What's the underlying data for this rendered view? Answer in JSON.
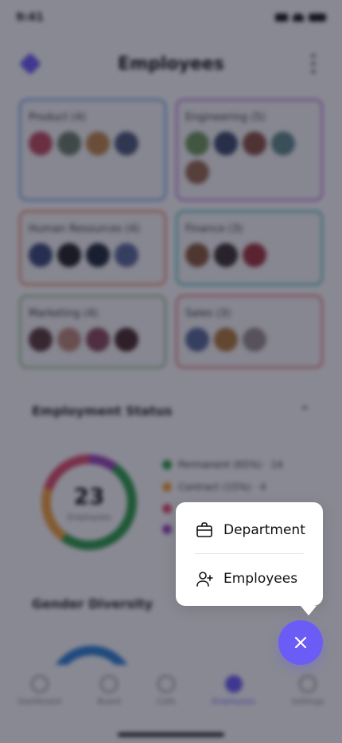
{
  "status_bar": {
    "time": "9:41"
  },
  "header": {
    "title": "Employees"
  },
  "departments": [
    {
      "name": "Product (4)",
      "color": "#4a90e2",
      "avatars": 4
    },
    {
      "name": "Engineering (5)",
      "color": "#b05bd1",
      "avatars": 5
    },
    {
      "name": "Human Resources (4)",
      "color": "#e56a3a",
      "avatars": 4
    },
    {
      "name": "Finance (3)",
      "color": "#2bb3b1",
      "avatars": 3
    },
    {
      "name": "Marketing (4)",
      "color": "#7bb36a",
      "avatars": 4
    },
    {
      "name": "Sales (3)",
      "color": "#e05a5a",
      "avatars": 3
    }
  ],
  "employment_status": {
    "title": "Employment Status",
    "total": "23",
    "total_label": "Employees",
    "legend": [
      {
        "label": "Permanent (65%) · 14",
        "color": "#2a9d46"
      },
      {
        "label": "Contract (15%) · 4",
        "color": "#f4a23a"
      },
      {
        "label": "",
        "color": "#e14b6a"
      },
      {
        "label": "",
        "color": "#9a44b5"
      }
    ]
  },
  "gender_diversity": {
    "title": "Gender Diversity"
  },
  "tabs": [
    {
      "label": "Dashboard",
      "active": false
    },
    {
      "label": "Board",
      "active": false
    },
    {
      "label": "Calls",
      "active": false
    },
    {
      "label": "Employees",
      "active": true
    },
    {
      "label": "Settings",
      "active": false
    }
  ],
  "menu": {
    "items": [
      {
        "label": "Department",
        "icon": "briefcase-icon"
      },
      {
        "label": "Employees",
        "icon": "user-plus-icon"
      }
    ]
  },
  "fab": {
    "icon": "close-icon",
    "color": "#6b5cf6"
  }
}
